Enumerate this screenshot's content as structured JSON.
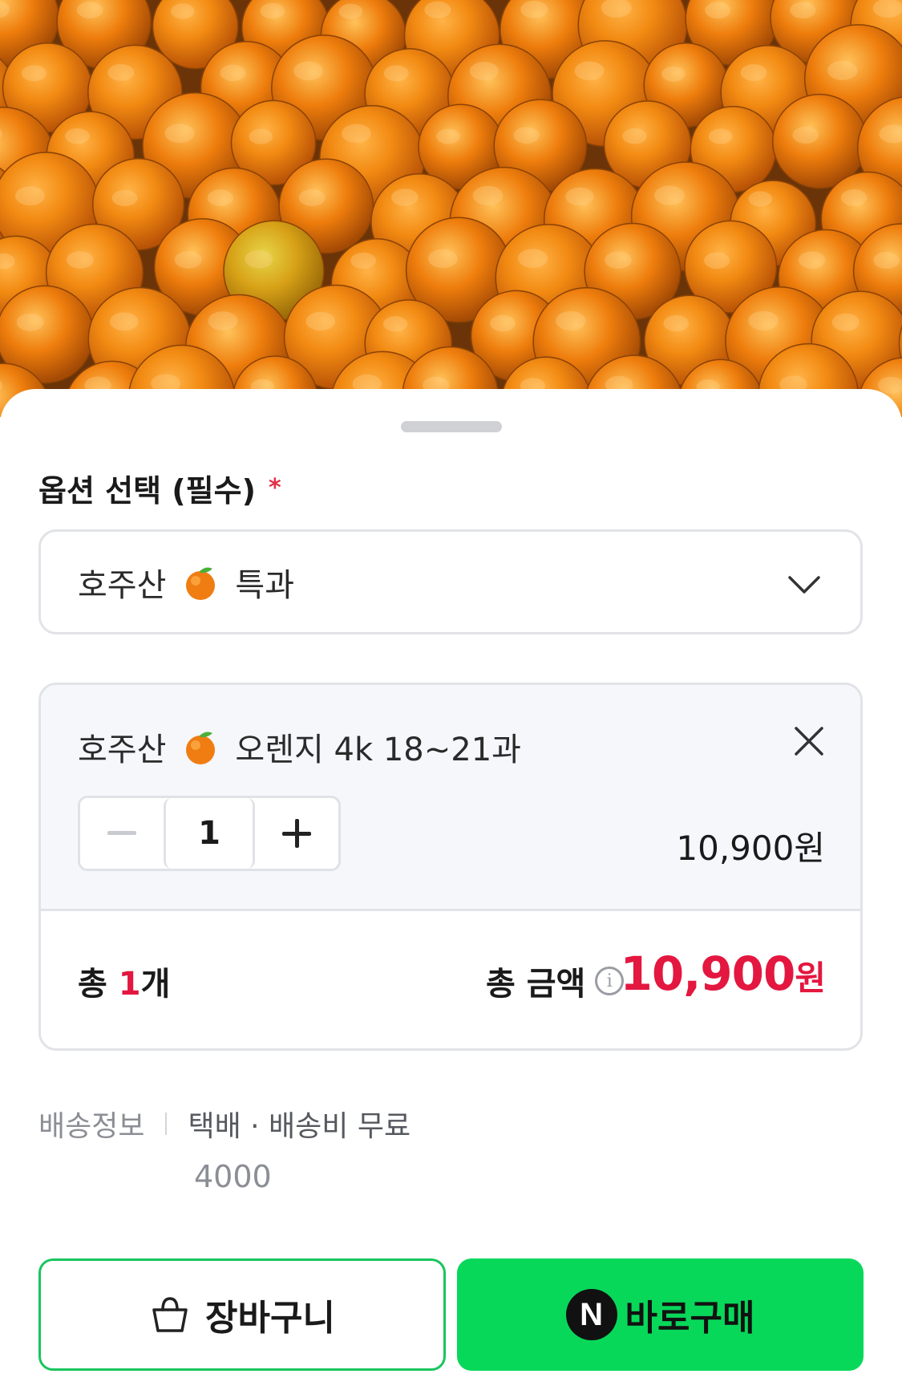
{
  "product": {
    "image_description": "oranges-photo"
  },
  "option": {
    "title": "옵션 선택 (필수)",
    "required_mark": "*",
    "selected_prefix": "호주산",
    "selected_suffix": "특과"
  },
  "selected_item": {
    "name_prefix": "호주산",
    "name_suffix": "오렌지 4k 18~21과",
    "quantity": "1",
    "price": "10,900원"
  },
  "total": {
    "count_prefix": "총 ",
    "count_value": "1",
    "count_suffix": "개",
    "amount_label": "총 금액",
    "amount_value": "10,900",
    "amount_unit": "원"
  },
  "delivery": {
    "label": "배송정보",
    "method": "택배 · 배송비 무료",
    "fee": "4000"
  },
  "buttons": {
    "cart": "장바구니",
    "buy_logo": "N",
    "buy": "바로구매"
  },
  "colors": {
    "accent_red": "#e3173f",
    "npay_green": "#08d85a",
    "cart_border": "#19c55e"
  },
  "icons": {
    "chevron": "chevron-down-icon",
    "close": "close-icon",
    "minus": "minus-icon",
    "plus": "plus-icon",
    "info": "info-icon",
    "cart": "shopping-bag-icon",
    "orange": "orange-emoji-icon"
  }
}
